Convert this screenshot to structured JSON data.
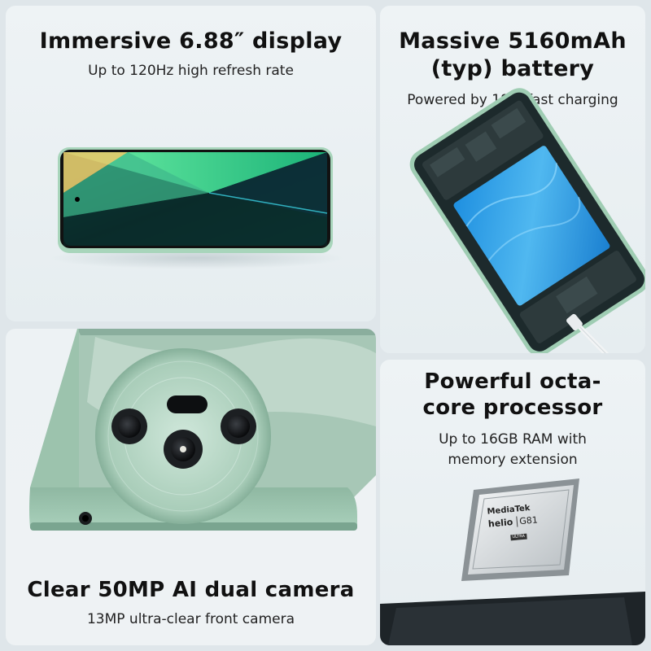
{
  "display": {
    "title": "Immersive 6.88″ display",
    "subtitle": "Up to 120Hz high refresh rate"
  },
  "battery": {
    "title_line1": "Massive 5160mAh",
    "title_line2": "(typ) battery",
    "subtitle": "Powered by 18W fast charging"
  },
  "camera": {
    "title": "Clear 50MP AI dual camera",
    "subtitle": "13MP ultra-clear front camera"
  },
  "processor": {
    "title_line1": "Powerful octa-",
    "title_line2": "core processor",
    "subtitle_line1": "Up to 16GB RAM with",
    "subtitle_line2": "memory extension",
    "chip_brand": "MediaTek",
    "chip_series": "helio",
    "chip_model": "G81",
    "chip_badge": "ULTRA"
  },
  "colors": {
    "phone_mint": "#9fcdb3",
    "screen_dark": "#0b3b33",
    "screen_green": "#2bd48a",
    "battery_blue": "#3aa0e8"
  }
}
